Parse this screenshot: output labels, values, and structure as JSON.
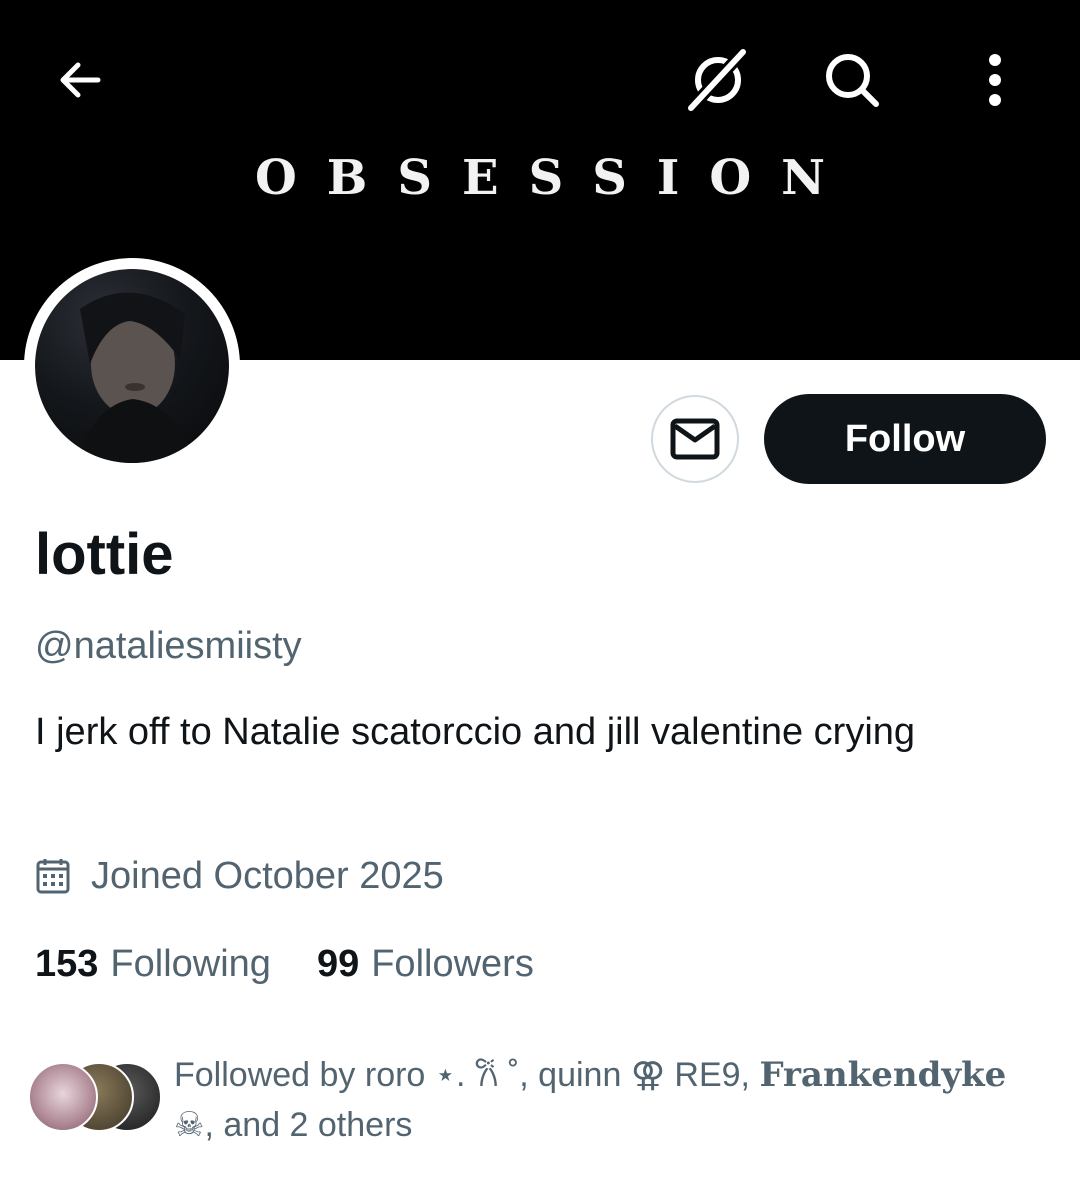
{
  "header": {
    "banner_title": "OBSESSION",
    "back_icon": "back-arrow-icon",
    "grok_icon": "grok-icon",
    "search_icon": "search-icon",
    "more_icon": "more-vertical-icon"
  },
  "profile": {
    "display_name": "lottie",
    "handle": "@nataliesmiisty",
    "bio": "I jerk off to Natalie scatorccio and jill valentine crying",
    "joined": "Joined October 2025",
    "follow_label": "Follow",
    "message_icon": "envelope-icon"
  },
  "stats": {
    "following_count": "153",
    "following_label": "Following",
    "followers_count": "99",
    "followers_label": "Followers"
  },
  "followed_by": {
    "prefix": "Followed by roro ⋆. 𐙚 ˚, quinn ⚢ RE9, ",
    "bold_name": "Frankendyke",
    "suffix": "☠︎, and 2 others"
  },
  "colors": {
    "primary_text": "#0f1419",
    "secondary_text": "#536471",
    "follow_button_bg": "#0f1419",
    "banner_bg": "#000000"
  }
}
